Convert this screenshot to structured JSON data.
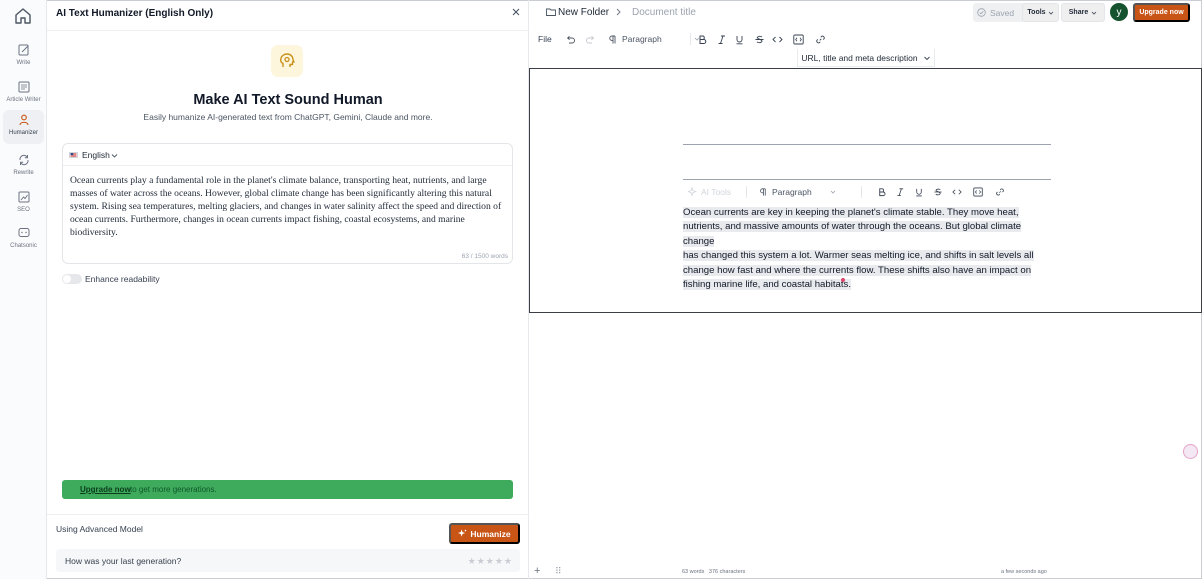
{
  "rail": {
    "items": [
      {
        "label": "Write",
        "icon": "edit-icon"
      },
      {
        "label": "Article Writer",
        "icon": "article-icon"
      },
      {
        "label": "Humanizer",
        "icon": "person-icon"
      },
      {
        "label": "Rewrite",
        "icon": "rewrite-icon"
      },
      {
        "label": "SEO",
        "icon": "seo-icon"
      },
      {
        "label": "Chatsonic",
        "icon": "chat-icon"
      }
    ],
    "active": "Humanizer"
  },
  "panel": {
    "title": "AI Text Humanizer (English Only)",
    "heading": "Make AI Text Sound Human",
    "subheading": "Easily humanize AI-generated text from ChatGPT, Gemini, Claude and more.",
    "language": "English",
    "input_text": "Ocean currents play a fundamental role in the planet's climate balance, transporting heat, nutrients, and large masses of water across the oceans. However, global climate change has been significantly altering this natural system. Rising sea temperatures, melting glaciers, and changes in water salinity affect the speed and direction of ocean currents. Furthermore, changes in ocean currents impact fishing, coastal ecosystems, and marine biodiversity.",
    "word_count": "63 / 1500 words",
    "enhance_label": "Enhance readability",
    "enhance_on": false,
    "upgrade_link": "Upgrade now",
    "upgrade_rest": "to get more generations.",
    "model_label": "Using Advanced Model",
    "humanize_label": "Humanize",
    "feedback_question": "How was your last generation?",
    "rating": 0
  },
  "topbar": {
    "folder": "New Folder",
    "doc_title": "Document title",
    "saved": "Saved",
    "tools": "Tools",
    "share": "Share",
    "avatar": "y",
    "upgrade": "Upgrade now"
  },
  "toolbar": {
    "file": "File",
    "paragraph": "Paragraph"
  },
  "meta": {
    "label": "URL, title and meta description"
  },
  "editor": {
    "ai_tools": "AI Tools",
    "paragraph": "Paragraph",
    "lines": [
      "Ocean currents are key in keeping the planet's climate stable. They move heat,",
      "nutrients, and massive amounts of water through the oceans. But global climate change",
      "has changed this system a lot. Warmer seas melting ice, and shifts in salt levels all",
      "change how fast and where the currents flow. These shifts also have an impact on",
      "fishing marine life, and coastal habitats."
    ]
  },
  "footer": {
    "words": "63 words",
    "characters": "376 characters",
    "time": "a few seconds ago"
  },
  "colors": {
    "accent": "#c85416",
    "banner": "#3daa5c",
    "avatar": "#14532d"
  }
}
